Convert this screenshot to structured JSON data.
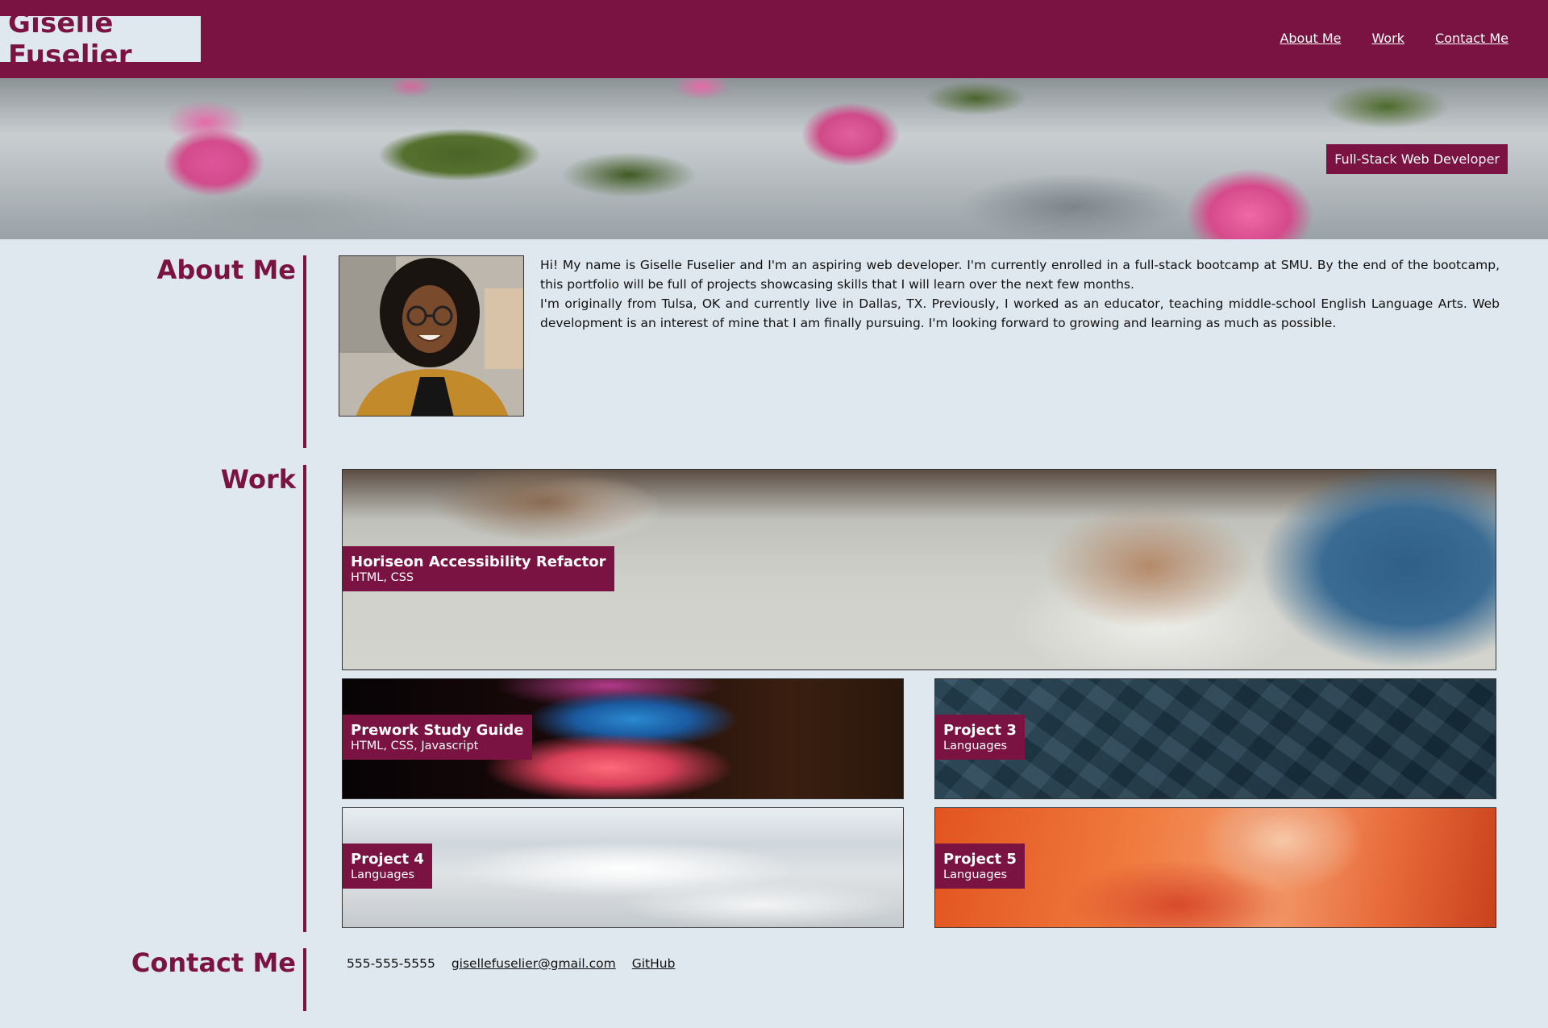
{
  "header": {
    "brand": "Giselle Fuselier",
    "nav": [
      "About Me",
      "Work",
      "Contact Me"
    ]
  },
  "hero": {
    "badge": "Full-Stack Web Developer"
  },
  "about": {
    "title": "About Me",
    "paragraph1": "Hi! My name is Giselle Fuselier and I'm an aspiring web developer. I'm currently enrolled in a full-stack bootcamp at SMU. By the end of the bootcamp, this portfolio will be full of projects showcasing skills that I will learn over the next few months.",
    "paragraph2": "I'm originally from Tulsa, OK and currently live in Dallas, TX. Previously, I worked as an educator, teaching middle-school English Language Arts. Web development is an interest of mine that I am finally pursuing. I'm looking forward to growing and learning as much as possible."
  },
  "work": {
    "title": "Work",
    "projects": [
      {
        "name": "Horiseon Accessibility Refactor",
        "languages": "HTML, CSS"
      },
      {
        "name": "Prework Study Guide",
        "languages": "HTML, CSS, Javascript"
      },
      {
        "name": "Project 3",
        "languages": "Languages"
      },
      {
        "name": "Project 4",
        "languages": "Languages"
      },
      {
        "name": "Project 5",
        "languages": "Languages"
      }
    ]
  },
  "contact": {
    "title": "Contact Me",
    "phone": "555-555-5555",
    "email": "gisellefuselier@gmail.com",
    "github": "GitHub"
  },
  "colors": {
    "accent": "#7a1342",
    "background": "#e0e8ef"
  }
}
